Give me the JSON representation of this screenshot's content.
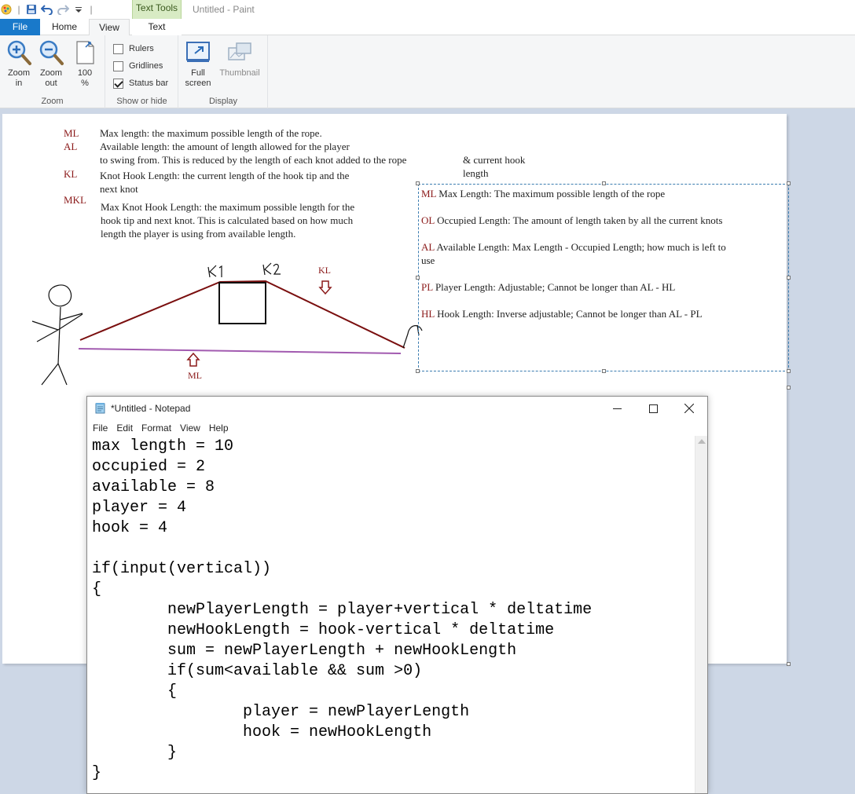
{
  "paint": {
    "title": "Untitled - Paint",
    "context_tab_group": "Text Tools",
    "tabs": {
      "file": "File",
      "home": "Home",
      "view": "View",
      "text": "Text"
    },
    "zoom_group": {
      "label": "Zoom",
      "zoom_in": [
        "Zoom",
        "in"
      ],
      "zoom_out": [
        "Zoom",
        "out"
      ],
      "hundred": [
        "100",
        "%"
      ]
    },
    "show_group": {
      "label": "Show or hide",
      "rulers": {
        "label": "Rulers",
        "checked": false
      },
      "gridlines": {
        "label": "Gridlines",
        "checked": false
      },
      "status_bar": {
        "label": "Status bar",
        "checked": true
      }
    },
    "display_group": {
      "label": "Display",
      "full_screen": [
        "Full",
        "screen"
      ],
      "thumbnail": "Thumbnail"
    },
    "colors": {
      "accent": "#1979ca",
      "context_tab": "#d8ebc4",
      "abbr_red": "#8b1a1a",
      "rope": "#7a0f0f",
      "ml_line": "#a25bb0"
    }
  },
  "canvas": {
    "legend": [
      {
        "abbr": "ML",
        "lines": [
          "Max length: the maximum possible length of the rope."
        ]
      },
      {
        "abbr": "AL",
        "lines": [
          "Available length: the amount of length allowed for the player",
          "to swing from. This is reduced by the length of each knot added to the rope"
        ]
      },
      {
        "abbr": "KL",
        "lines": [
          "Knot Hook Length: the current length of the hook tip and the",
          "next knot"
        ]
      },
      {
        "abbr": "MKL",
        "lines": [
          "Max Knot Hook Length: the maximum possible length for the",
          "hook tip and next knot. This is calculated based on how much",
          "length the player is using from available length."
        ]
      }
    ],
    "side_note": [
      "& current hook",
      "length"
    ],
    "diagram_labels": {
      "k1": "k1",
      "k2": "k2",
      "kl": "KL",
      "ml": "ML"
    },
    "textbox": [
      {
        "abbr": "ML",
        "text": " Max Length: The maximum possible length of the rope"
      },
      {
        "abbr": "OL",
        "text": " Occupied Length: The amount of length taken by all the current knots"
      },
      {
        "abbr": "AL",
        "text": " Available Length: Max Length - Occupied Length; how much is left to",
        "cont": "use"
      },
      {
        "abbr": "PL",
        "text": " Player Length: Adjustable; Cannot be longer than AL - HL"
      },
      {
        "abbr": "HL",
        "text": " Hook Length: Inverse adjustable; Cannot be longer than AL - PL"
      }
    ]
  },
  "notepad": {
    "title": "*Untitled - Notepad",
    "menu": [
      "File",
      "Edit",
      "Format",
      "View",
      "Help"
    ],
    "content": "max length = 10\noccupied = 2\navailable = 8\nplayer = 4\nhook = 4\n\nif(input(vertical))\n{\n        newPlayerLength = player+vertical * deltatime\n        newHookLength = hook-vertical * deltatime\n        sum = newPlayerLength + newHookLength\n        if(sum<available && sum >0)\n        {\n                player = newPlayerLength\n                hook = newHookLength\n        }\n}"
  }
}
